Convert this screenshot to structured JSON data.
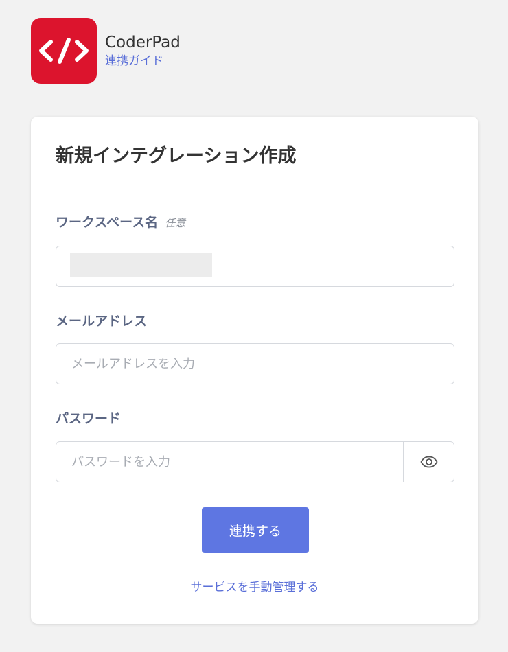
{
  "header": {
    "app_name": "CoderPad",
    "guide_link": "連携ガイド",
    "logo_icon": "code-brackets-icon"
  },
  "form": {
    "title": "新規インテグレーション作成",
    "workspace": {
      "label": "ワークスペース名",
      "optional": "任意",
      "value": ""
    },
    "email": {
      "label": "メールアドレス",
      "placeholder": "メールアドレスを入力",
      "value": ""
    },
    "password": {
      "label": "パスワード",
      "placeholder": "パスワードを入力",
      "value": "",
      "toggle_icon": "eye-icon"
    },
    "submit_label": "連携する",
    "manual_link": "サービスを手動管理する"
  },
  "colors": {
    "logo_bg": "#dc142d",
    "accent": "#5e76e2",
    "link": "#5a6fd8",
    "label": "#5b6683",
    "page_bg": "#f2f2f2"
  }
}
